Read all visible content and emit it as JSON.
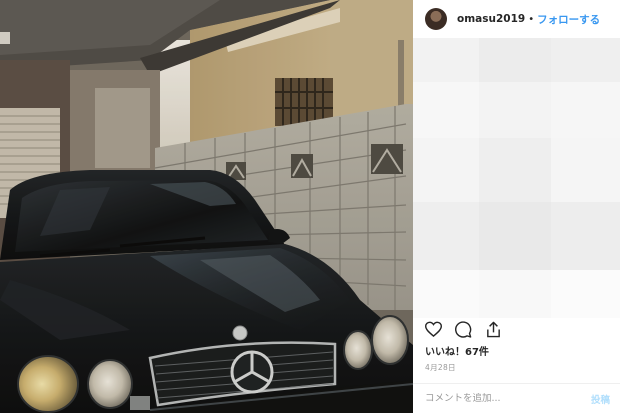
{
  "header": {
    "username": "omasu2019",
    "separator": "•",
    "follow_label": "フォローする"
  },
  "photo": {
    "subject": "black Mercedes-Benz parked in a carport beside a block wall"
  },
  "actions": {
    "like_icon": "heart-icon",
    "comment_icon": "speech-bubble-icon",
    "share_icon": "share-arrow-icon"
  },
  "likes_text": "いいね！67件",
  "date_text": "4月28日",
  "comment_box": {
    "placeholder": "コメントを追加...",
    "post_label": "投稿"
  },
  "colors": {
    "link_blue": "#3897f0",
    "post_disabled": "#b2dffc",
    "muted_text": "#999999"
  }
}
